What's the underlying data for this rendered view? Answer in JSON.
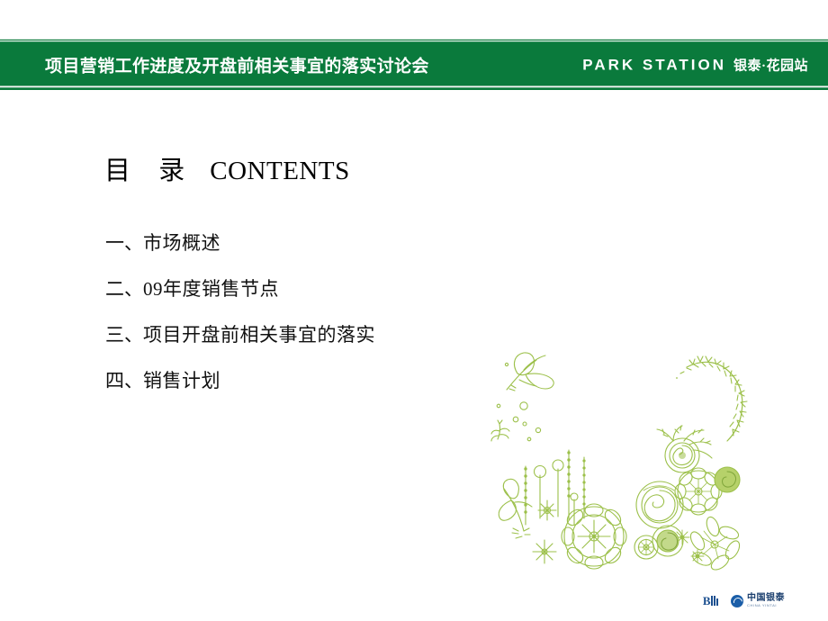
{
  "slide": {
    "background_color": "#ffffff",
    "accent_green": "#0a7a3c",
    "decor_green": "#9cc04a"
  },
  "header": {
    "title": "项目营销工作进度及开盘前相关事宜的落实讨论会",
    "brand_en": "PARK STATION",
    "brand_cn": "银泰·花园站"
  },
  "contents": {
    "heading_cn": "目 录",
    "heading_en": "CONTENTS",
    "items": [
      {
        "num": "一、",
        "label": "市场概述"
      },
      {
        "num": "二、",
        "label": "09年度销售节点"
      },
      {
        "num": "三、",
        "label": "项目开盘前相关事宜的落实"
      },
      {
        "num": "四、",
        "label": "销售计划"
      }
    ]
  },
  "decoration": {
    "name": "floral-line-art",
    "color": "#9cc04a"
  },
  "footer": {
    "logo_bii_text": "B",
    "logo_yintai_cn": "中国银泰",
    "logo_yintai_en": "CHINA YINTAI"
  }
}
